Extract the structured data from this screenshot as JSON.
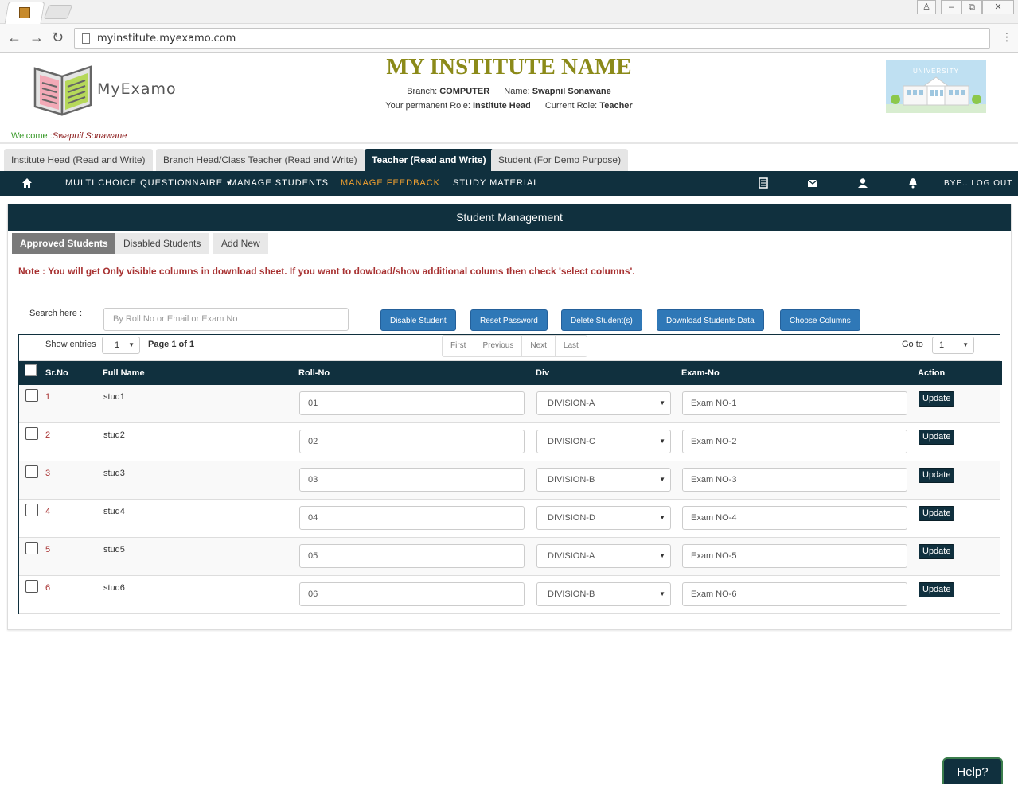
{
  "browser": {
    "url": "myinstitute.myexamo.com",
    "window_buttons": [
      "♙",
      "–",
      "⧉",
      "✕"
    ]
  },
  "header": {
    "logo_text": "MyExamo",
    "institute_name": "MY INSTITUTE NAME",
    "branch_label": "Branch:",
    "branch_value": "COMPUTER",
    "name_label": "Name:",
    "name_value": "Swapnil Sonawane",
    "perm_role_label": "Your permanent Role:",
    "perm_role_value": "Institute Head",
    "current_role_label": "Current Role:",
    "current_role_value": "Teacher",
    "univ_text": "UNIVERSITY",
    "welcome_label": "Welcome :",
    "welcome_name": "Swapnil Sonawane"
  },
  "role_tabs": [
    {
      "label": "Institute Head (Read and Write)",
      "active": false
    },
    {
      "label": "Branch Head/Class Teacher (Read and Write)",
      "active": false
    },
    {
      "label": "Teacher (Read and Write)",
      "active": true
    },
    {
      "label": "Student (For Demo Purpose)",
      "active": false
    }
  ],
  "nav": {
    "items": [
      "MULTI CHOICE QUESTIONNAIRE",
      "MANAGE STUDENTS",
      "MANAGE FEEDBACK",
      "STUDY MATERIAL"
    ],
    "highlighted": "MANAGE FEEDBACK",
    "logout": "BYE.. LOG OUT",
    "accent_color": "#f0a030"
  },
  "panel": {
    "title": "Student Management",
    "sub_tabs": [
      "Approved Students",
      "Disabled Students",
      "Add New"
    ],
    "note": "Note : You will get Only visible columns in download sheet. If you want to dowload/show additional colums then check 'select columns'.",
    "search_label": "Search here :",
    "search_placeholder": "By Roll No or Email or Exam No",
    "buttons": [
      "Disable Student",
      "Reset Password",
      "Delete Student(s)",
      "Download Students Data",
      "Choose Columns"
    ],
    "show_entries_label": "Show entries",
    "show_entries_value": "1",
    "page_info": "Page  1 of 1",
    "pager": [
      "First",
      "Previous",
      "Next",
      "Last"
    ],
    "goto_label": "Go to",
    "goto_value": "1"
  },
  "table": {
    "columns": [
      "Sr.No",
      "Full Name",
      "Roll-No",
      "Div",
      "Exam-No",
      "Action"
    ],
    "action_label": "Update",
    "rows": [
      {
        "sr": "1",
        "name": "stud1",
        "roll": "01",
        "div": "DIVISION-A",
        "exam": "Exam NO-1"
      },
      {
        "sr": "2",
        "name": "stud2",
        "roll": "02",
        "div": "DIVISION-C",
        "exam": "Exam NO-2"
      },
      {
        "sr": "3",
        "name": "stud3",
        "roll": "03",
        "div": "DIVISION-B",
        "exam": "Exam NO-3"
      },
      {
        "sr": "4",
        "name": "stud4",
        "roll": "04",
        "div": "DIVISION-D",
        "exam": "Exam NO-4"
      },
      {
        "sr": "5",
        "name": "stud5",
        "roll": "05",
        "div": "DIVISION-A",
        "exam": "Exam NO-5"
      },
      {
        "sr": "6",
        "name": "stud6",
        "roll": "06",
        "div": "DIVISION-B",
        "exam": "Exam NO-6"
      }
    ]
  },
  "help_label": "Help?",
  "colors": {
    "dark": "#10303e",
    "button_blue": "#2f78b7",
    "note_red": "#a83232",
    "title_olive": "#8b8a19"
  }
}
